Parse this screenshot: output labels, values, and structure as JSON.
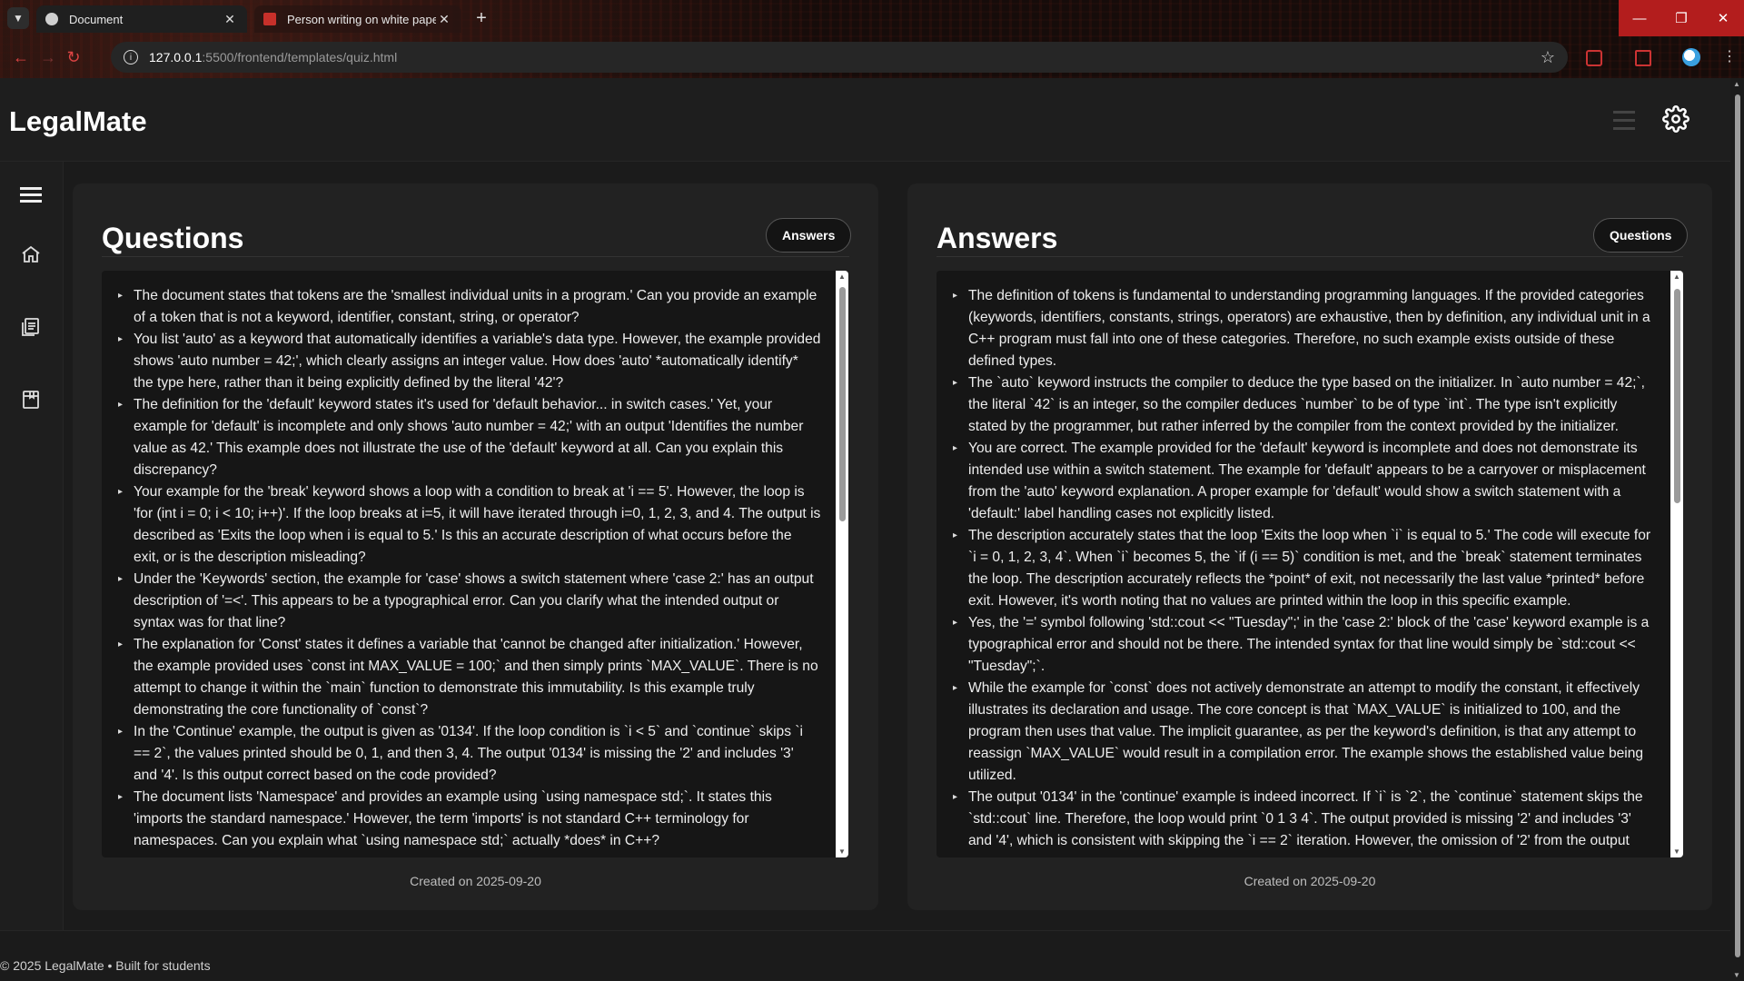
{
  "browser": {
    "tabs": [
      {
        "title": "Document"
      },
      {
        "title": "Person writing on white paper"
      }
    ],
    "url_host": "127.0.0.1",
    "url_rest": ":5500/frontend/templates/quiz.html"
  },
  "app": {
    "brand": "LegalMate"
  },
  "questions_panel": {
    "title": "Questions",
    "toggle_label": "Answers",
    "created": "Created on 2025-09-20",
    "items": [
      "The document states that tokens are the 'smallest individual units in a program.' Can you provide an example of a token that is not a keyword, identifier, constant, string, or operator?",
      "You list 'auto' as a keyword that automatically identifies a variable's data type. However, the example provided shows 'auto number = 42;', which clearly assigns an integer value. How does 'auto' *automatically identify* the type here, rather than it being explicitly defined by the literal '42'?",
      "The definition for the 'default' keyword states it's used for 'default behavior... in switch cases.' Yet, your example for 'default' is incomplete and only shows 'auto number = 42;' with an output 'Identifies the number value as 42.' This example does not illustrate the use of the 'default' keyword at all. Can you explain this discrepancy?",
      "Your example for the 'break' keyword shows a loop with a condition to break at 'i == 5'. However, the loop is 'for (int i = 0; i < 10; i++)'. If the loop breaks at i=5, it will have iterated through i=0, 1, 2, 3, and 4. The output is described as 'Exits the loop when i is equal to 5.' Is this an accurate description of what occurs before the exit, or is the description misleading?",
      "Under the 'Keywords' section, the example for 'case' shows a switch statement where 'case 2:' has an output description of '=<'. This appears to be a typographical error. Can you clarify what the intended output or syntax was for that line?",
      "The explanation for 'Const' states it defines a variable that 'cannot be changed after initialization.' However, the example provided uses `const int MAX_VALUE = 100;` and then simply prints `MAX_VALUE`. There is no attempt to change it within the `main` function to demonstrate this immutability. Is this example truly demonstrating the core functionality of `const`?",
      "In the 'Continue' example, the output is given as '0134'. If the loop condition is `i < 5` and `continue` skips `i == 2`, the values printed should be 0, 1, and then 3, 4. The output '0134' is missing the '2' and includes '3' and '4'. Is this output correct based on the code provided?",
      "The document lists 'Namespace' and provides an example using `using namespace std;`. It states this 'imports the standard namespace.' However, the term 'imports' is not standard C++ terminology for namespaces. Can you explain what `using namespace std;` actually *does* in C++?"
    ]
  },
  "answers_panel": {
    "title": "Answers",
    "toggle_label": "Questions",
    "created": "Created on 2025-09-20",
    "items": [
      "The definition of tokens is fundamental to understanding programming languages. If the provided categories (keywords, identifiers, constants, strings, operators) are exhaustive, then by definition, any individual unit in a C++ program must fall into one of these categories. Therefore, no such example exists outside of these defined types.",
      "The `auto` keyword instructs the compiler to deduce the type based on the initializer. In `auto number = 42;`, the literal `42` is an integer, so the compiler deduces `number` to be of type `int`. The type isn't explicitly stated by the programmer, but rather inferred by the compiler from the context provided by the initializer.",
      "You are correct. The example provided for the 'default' keyword is incomplete and does not demonstrate its intended use within a switch statement. The example for 'default' appears to be a carryover or misplacement from the 'auto' keyword explanation. A proper example for 'default' would show a switch statement with a 'default:' label handling cases not explicitly listed.",
      "The description accurately states that the loop 'Exits the loop when `i` is equal to 5.' The code will execute for `i = 0, 1, 2, 3, 4`. When `i` becomes 5, the `if (i == 5)` condition is met, and the `break` statement terminates the loop. The description accurately reflects the *point* of exit, not necessarily the last value *printed* before exit. However, it's worth noting that no values are printed within the loop in this specific example.",
      "Yes, the '=' symbol following 'std::cout << \"Tuesday\";' in the 'case 2:' block of the 'case' keyword example is a typographical error and should not be there. The intended syntax for that line would simply be `std::cout << \"Tuesday\";`.",
      "While the example for `const` does not actively demonstrate an attempt to modify the constant, it effectively illustrates its declaration and usage. The core concept is that `MAX_VALUE` is initialized to 100, and the program then uses that value. The implicit guarantee, as per the keyword's definition, is that any attempt to reassign `MAX_VALUE` would result in a compilation error. The example shows the established value being utilized.",
      "The output '0134' in the 'continue' example is indeed incorrect. If `i` is `2`, the `continue` statement skips the `std::cout` line. Therefore, the loop would print `0 1 3 4`. The output provided is missing '2' and includes '3' and '4', which is consistent with skipping the `i == 2` iteration. However, the omission of '2' from the output"
    ]
  },
  "footer": {
    "text": "© 2025 LegalMate • Built for students"
  },
  "icons": {
    "gear": "gear-icon",
    "home": "home-icon",
    "notes": "notes-icon",
    "quiz": "quiz-icon",
    "menu": "menu-icon"
  },
  "colors": {
    "accent_red": "#b31d1d",
    "panel_bg": "#222222",
    "list_bg": "#161616"
  }
}
